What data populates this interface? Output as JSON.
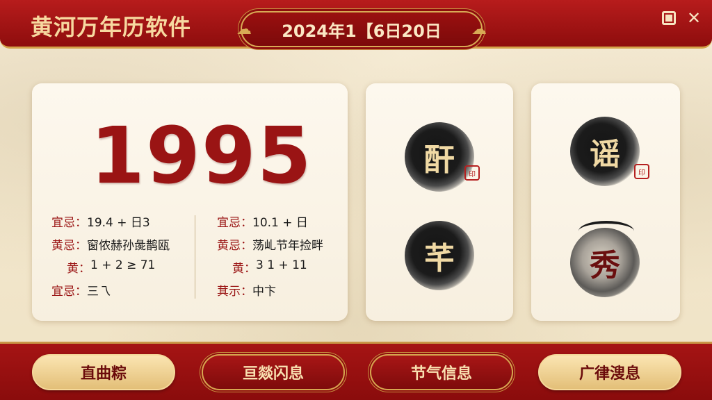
{
  "app": {
    "title": "黄河万年历软件",
    "date": "2024年1【6日20日"
  },
  "main_card": {
    "year": "1995",
    "left_rows": [
      {
        "label": "宜忌：",
        "value": "19.4 + 日3"
      },
      {
        "label": "黄忌：",
        "value": "窗侬赫孙彘鹊瓯"
      },
      {
        "label": "黄：",
        "value": "1 + 2 ≥ 71"
      },
      {
        "label": "宜忌：",
        "value": "三乁"
      }
    ],
    "right_rows": [
      {
        "label": "宜忌：",
        "value": "10.1 + 日"
      },
      {
        "label": "黄忌：",
        "value": "荡乢节年捡畔"
      },
      {
        "label": "黄：",
        "value": "3 1 + 11"
      },
      {
        "label": "萁示：",
        "value": "中卞"
      }
    ]
  },
  "icon_cards": [
    {
      "top_char": "酐",
      "bottom_char": "芊",
      "seal": "印"
    },
    {
      "top_char": "谣",
      "bottom_char": "秀",
      "seal": "印"
    }
  ],
  "bottom_nav": [
    {
      "label": "直曲粽",
      "style": "gold"
    },
    {
      "label": "亘燚闪息",
      "style": "red"
    },
    {
      "label": "节气信息",
      "style": "red"
    },
    {
      "label": "广律溲息",
      "style": "gold"
    }
  ],
  "colors": {
    "primary_red": "#9a1414",
    "gold": "#d8aa55",
    "paper": "#f3e8cf"
  }
}
